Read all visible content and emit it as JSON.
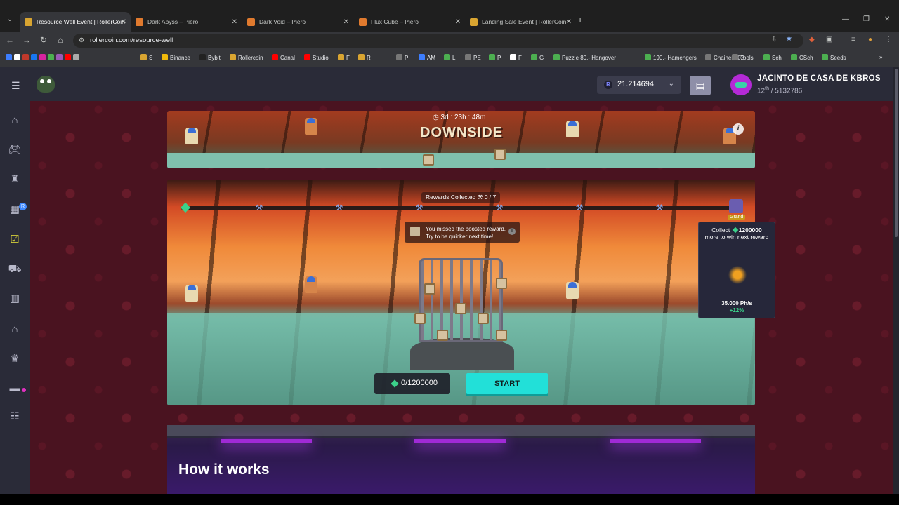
{
  "browser": {
    "tabs": [
      {
        "title": "Resource Well Event | RollerCoin",
        "active": true
      },
      {
        "title": "Dark Abyss – Piero",
        "active": false
      },
      {
        "title": "Dark Void – Piero",
        "active": false
      },
      {
        "title": "Flux Cube – Piero",
        "active": false
      },
      {
        "title": "Landing Sale Event | RollerCoin",
        "active": false
      }
    ],
    "url": "rollercoin.com/resource-well",
    "bookmarks": [
      "S",
      "Binance",
      "Bybit",
      "Rollercoin",
      "Canal",
      "Studio",
      "F",
      "R",
      "P",
      "AM",
      "L",
      "PE",
      "P",
      "F",
      "G",
      "Puzzle 80.- Hangover",
      "190.- Hamengers",
      "Chainers 02",
      "Tools",
      "Sch",
      "CSch",
      "Seeds"
    ]
  },
  "header": {
    "balance": "21.214694",
    "currency_icon": "R",
    "username": "JACINTO DE CASA DE KBROS",
    "rank_position": "12",
    "rank_suffix": "th",
    "rank_total": "/ 5132786"
  },
  "sidebar": {
    "icons": [
      "home-icon",
      "gamepad-icon",
      "rollertoken-icon",
      "calendar-icon",
      "event-icon",
      "cart-icon",
      "storage-icon",
      "house-icon",
      "trophy-icon",
      "machine-icon",
      "list-icon"
    ],
    "badge": "R"
  },
  "banner": {
    "timer": "3d : 23h : 48m",
    "title": "DOWNSIDE",
    "info": "i"
  },
  "game": {
    "rewards_label": "Rewards Collected",
    "rewards_value": "0 / 7",
    "missed_line1": "You missed the boosted reward.",
    "missed_line2": "Try to be quicker next time!",
    "grand_label": "Grand",
    "counter": "0/1200000",
    "start_label": "START"
  },
  "tooltip": {
    "collect_prefix": "Collect",
    "collect_amount": "1200000",
    "collect_suffix": "more to win next reward",
    "power": "35.000 Ph/s",
    "bonus": "+12%"
  },
  "howto": {
    "title": "How it works"
  },
  "colors": {
    "accent_cyan": "#22e0d8",
    "gem_green": "#3bd18a",
    "bg_maroon": "#4a1320",
    "panel_dark": "#2a2b38"
  }
}
